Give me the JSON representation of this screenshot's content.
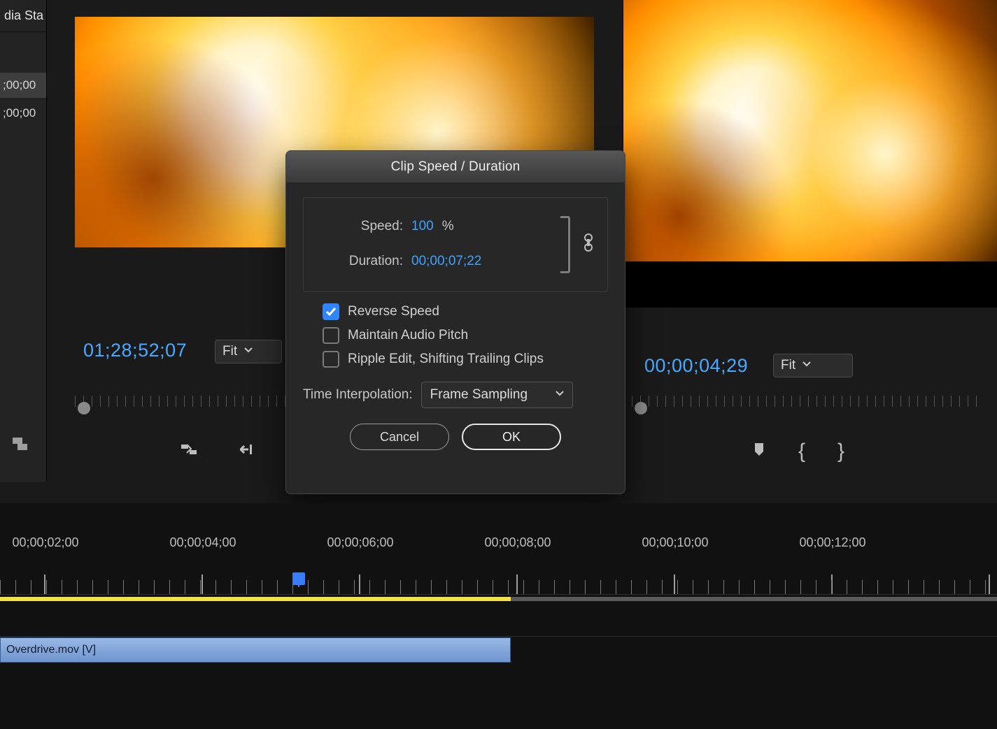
{
  "left_sliver": {
    "tab_text": "dia Sta",
    "tc1": ";00;00",
    "tc2": ";00;00"
  },
  "source": {
    "timecode": "01;28;52;07",
    "zoom": "Fit"
  },
  "program": {
    "timecode": "00;00;04;29",
    "zoom": "Fit"
  },
  "dialog": {
    "title": "Clip Speed / Duration",
    "speed_label": "Speed:",
    "speed_value": "100",
    "speed_suffix": "%",
    "duration_label": "Duration:",
    "duration_value": "00;00;07;22",
    "reverse_label": "Reverse Speed",
    "reverse_checked": true,
    "pitch_label": "Maintain Audio Pitch",
    "pitch_checked": false,
    "ripple_label": "Ripple Edit, Shifting Trailing Clips",
    "ripple_checked": false,
    "interp_label": "Time Interpolation:",
    "interp_value": "Frame Sampling",
    "cancel": "Cancel",
    "ok": "OK"
  },
  "timeline": {
    "labels": [
      "00;00;02;00",
      "00;00;04;00",
      "00;00;06;00",
      "00;00;08;00",
      "00;00;10;00",
      "00;00;12;00"
    ],
    "clip_name": "Overdrive.mov [V]"
  }
}
